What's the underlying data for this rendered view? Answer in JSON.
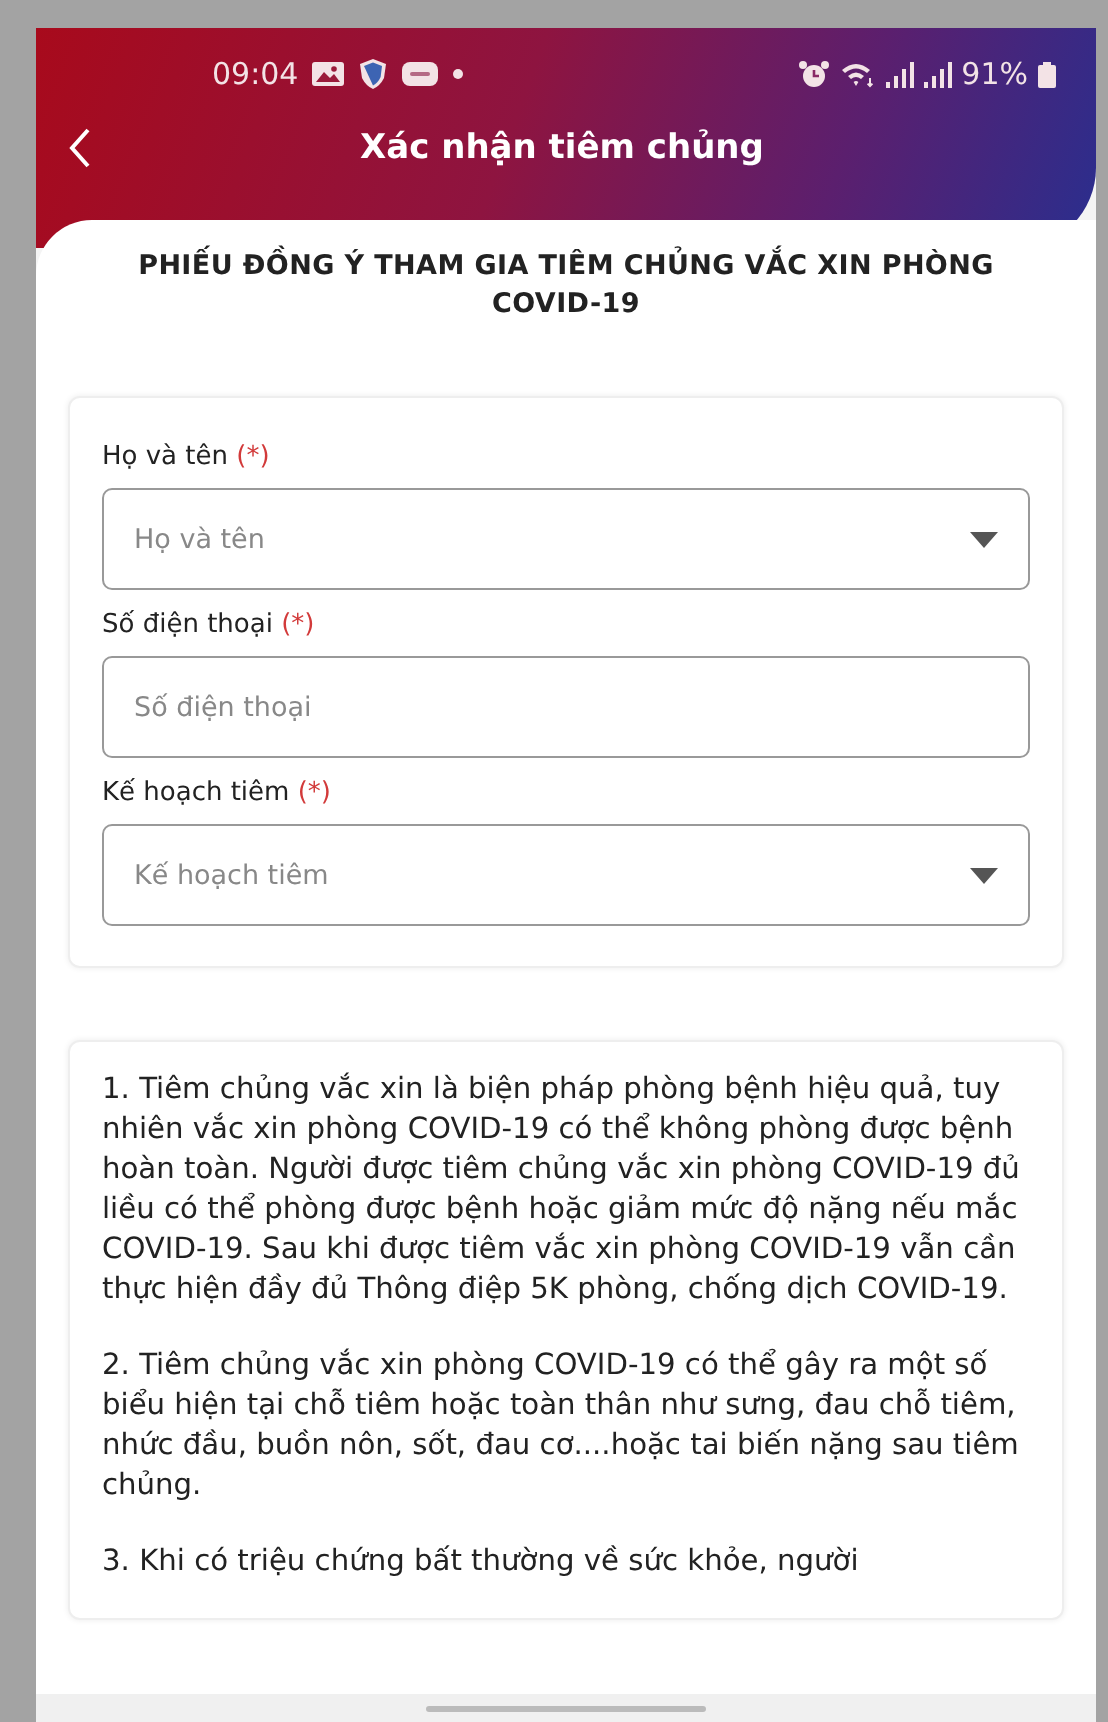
{
  "status_bar": {
    "time": "09:04",
    "battery": "91%"
  },
  "header": {
    "title": "Xác nhận tiêm chủng"
  },
  "form": {
    "title": "PHIẾU ĐỒNG Ý THAM GIA TIÊM CHỦNG VẮC XIN PHÒNG COVID-19",
    "fields": [
      {
        "label": "Họ và tên",
        "required_mark": "(*)",
        "placeholder": "Họ và tên",
        "kind": "dropdown"
      },
      {
        "label": "Số điện thoại",
        "required_mark": "(*)",
        "placeholder": "Số điện thoại",
        "kind": "text"
      },
      {
        "label": "Kế hoạch tiêm",
        "required_mark": "(*)",
        "placeholder": "Kế hoạch tiêm",
        "kind": "dropdown"
      }
    ]
  },
  "terms": {
    "paragraphs": [
      "1. Tiêm chủng vắc xin là biện pháp phòng bệnh hiệu quả, tuy nhiên vắc xin phòng COVID-19 có thể không phòng được bệnh hoàn toàn. Người được tiêm chủng vắc xin phòng COVID-19 đủ liều có thể phòng được bệnh hoặc giảm mức độ nặng nếu mắc COVID-19. Sau khi được tiêm vắc xin phòng COVID-19 vẫn cần thực hiện đầy đủ Thông điệp 5K phòng, chống dịch COVID-19.",
      "2. Tiêm chủng vắc xin phòng COVID-19 có thể gây ra một số biểu hiện tại chỗ tiêm hoặc toàn thân như sưng, đau chỗ tiêm, nhức đầu, buồn nôn, sốt, đau cơ....hoặc tai biến nặng sau tiêm chủng.",
      "3. Khi có triệu chứng bất thường về sức khỏe, người"
    ]
  }
}
